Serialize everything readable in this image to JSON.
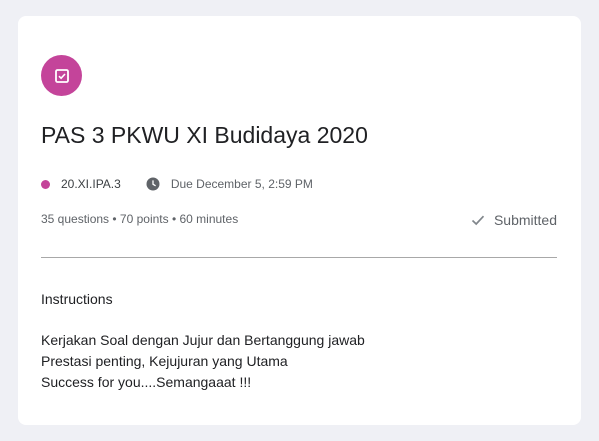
{
  "assignment": {
    "icon": "assignment-icon",
    "accent_color": "#c4449a",
    "title": "PAS 3 PKWU XI Budidaya 2020",
    "class_name": "20.XI.IPA.3",
    "class_dot_icon": "class-dot-icon",
    "due_icon": "clock-icon",
    "due": "Due December 5, 2:59 PM",
    "stats": "35 questions • 70 points • 60 minutes",
    "status_icon": "check-icon",
    "status": "Submitted"
  },
  "instructions": {
    "heading": "Instructions",
    "lines": [
      "Kerjakan Soal dengan Jujur dan Bertanggung jawab",
      "Prestasi penting, Kejujuran yang Utama",
      "Success for you....Semangaaat !!!"
    ]
  }
}
